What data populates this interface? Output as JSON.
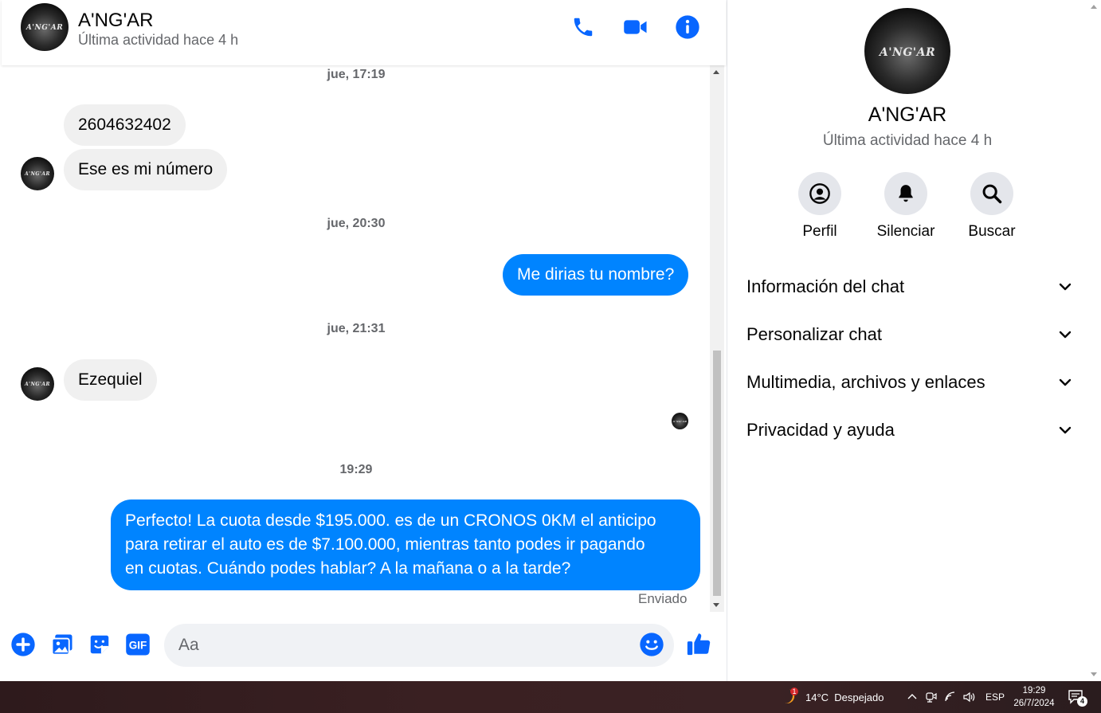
{
  "contact": {
    "name": "A'NG'AR",
    "status": "Última actividad hace 4 h",
    "logo_text": "A'NG'AR"
  },
  "messages": {
    "ts1": "jue, 17:19",
    "m1": "2604632402",
    "m2": "Ese es mi número",
    "ts2": "jue, 20:30",
    "m3": "Me dirias tu nombre?",
    "ts3": "jue, 21:31",
    "m4": "Ezequiel",
    "ts4": "19:29",
    "m5_line1": "Perfecto! La cuota desde $195.000. es de un CRONOS 0KM el anticipo",
    "m5_line2": "para retirar el auto es de $7.100.000, mientras tanto podes ir pagando",
    "m5_line3": "en cuotas. Cuándo podes hablar? A la mañana o a la tarde?",
    "sent_status": "Enviado"
  },
  "composer": {
    "placeholder": "Aa"
  },
  "info": {
    "actions": [
      "Perfil",
      "Silenciar",
      "Buscar"
    ],
    "sections": [
      "Información del chat",
      "Personalizar chat",
      "Multimedia, archivos y enlaces",
      "Privacidad y ayuda"
    ]
  },
  "taskbar": {
    "weather": "14°C  Despejado",
    "weather_badge": "1",
    "lang": "ESP",
    "time": "19:29",
    "date": "26/7/2024",
    "notif_count": "4"
  },
  "colors": {
    "accent": "#0084ff",
    "icon_blue": "#0866ff",
    "incoming_bubble": "#f0f0f0"
  }
}
